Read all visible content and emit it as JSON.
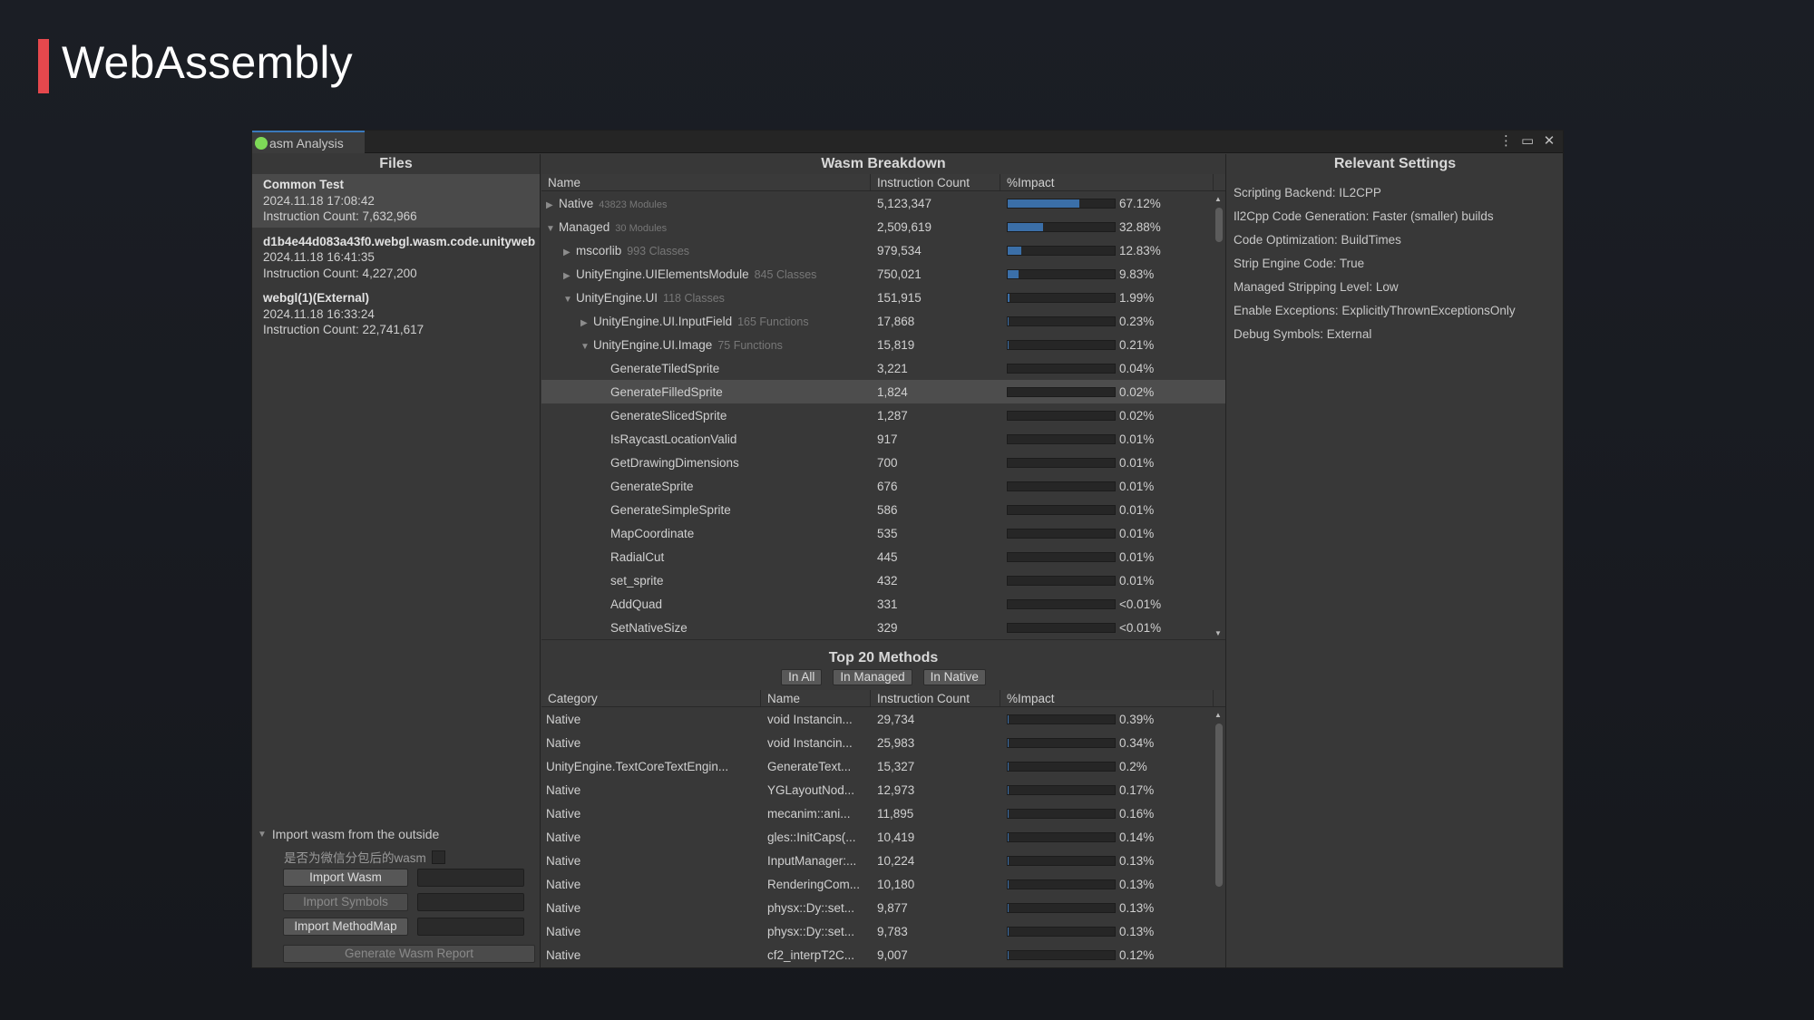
{
  "slide": {
    "title": "WebAssembly"
  },
  "window": {
    "tab_label": "asm Analysis",
    "controls": {
      "menu": "⋮",
      "maximize": "▭",
      "close": "✕"
    }
  },
  "files": {
    "header": "Files",
    "items": [
      {
        "name": "Common Test",
        "date": "2024.11.18 17:08:42",
        "count": "Instruction Count: 7,632,966"
      },
      {
        "name": "d1b4e44d083a43f0.webgl.wasm.code.unityweb",
        "date": "2024.11.18 16:41:35",
        "count": "Instruction Count: 4,227,200"
      },
      {
        "name": "webgl(1)(External)",
        "date": "2024.11.18 16:33:24",
        "count": "Instruction Count: 22,741,617"
      }
    ],
    "import": {
      "fold_label": "Import wasm from the outside",
      "checkbox_label": "是否为微信分包后的wasm",
      "import_wasm": "Import Wasm",
      "import_symbols": "Import Symbols",
      "import_methodmap": "Import MethodMap",
      "generate_report": "Generate Wasm Report"
    }
  },
  "breakdown": {
    "header": "Wasm Breakdown",
    "columns": [
      "Name",
      "Instruction Count",
      "%Impact"
    ],
    "rows": [
      {
        "arrow": "▶",
        "name": "Native",
        "note": "43823 Modules",
        "count": "5,123,347",
        "impact": 67.12,
        "pct": "67.12%"
      },
      {
        "arrow": "▼",
        "name": "Managed",
        "note": "30 Modules",
        "count": "2,509,619",
        "impact": 32.88,
        "pct": "32.88%"
      },
      {
        "arrow": "▶",
        "name": "mscorlib",
        "note": "993 Classes",
        "count": "979,534",
        "impact": 12.83,
        "pct": "12.83%"
      },
      {
        "arrow": "▶",
        "name": "UnityEngine.UIElementsModule",
        "note": "845 Classes",
        "count": "750,021",
        "impact": 9.83,
        "pct": "9.83%"
      },
      {
        "arrow": "▼",
        "name": "UnityEngine.UI",
        "note": "118 Classes",
        "count": "151,915",
        "impact": 1.99,
        "pct": "1.99%"
      },
      {
        "arrow": "▶",
        "name": "UnityEngine.UI.InputField",
        "note": "165 Functions",
        "count": "17,868",
        "impact": 0.23,
        "pct": "0.23%"
      },
      {
        "arrow": "▼",
        "name": "UnityEngine.UI.Image",
        "note": "75 Functions",
        "count": "15,819",
        "impact": 0.21,
        "pct": "0.21%"
      },
      {
        "arrow": "",
        "name": "GenerateTiledSprite",
        "note": "",
        "count": "3,221",
        "impact": 0.04,
        "pct": "0.04%"
      },
      {
        "arrow": "",
        "name": "GenerateFilledSprite",
        "note": "",
        "count": "1,824",
        "impact": 0.02,
        "pct": "0.02%"
      },
      {
        "arrow": "",
        "name": "GenerateSlicedSprite",
        "note": "",
        "count": "1,287",
        "impact": 0.02,
        "pct": "0.02%"
      },
      {
        "arrow": "",
        "name": "IsRaycastLocationValid",
        "note": "",
        "count": "917",
        "impact": 0.01,
        "pct": "0.01%"
      },
      {
        "arrow": "",
        "name": "GetDrawingDimensions",
        "note": "",
        "count": "700",
        "impact": 0.01,
        "pct": "0.01%"
      },
      {
        "arrow": "",
        "name": "GenerateSprite",
        "note": "",
        "count": "676",
        "impact": 0.01,
        "pct": "0.01%"
      },
      {
        "arrow": "",
        "name": "GenerateSimpleSprite",
        "note": "",
        "count": "586",
        "impact": 0.01,
        "pct": "0.01%"
      },
      {
        "arrow": "",
        "name": "MapCoordinate",
        "note": "",
        "count": "535",
        "impact": 0.01,
        "pct": "0.01%"
      },
      {
        "arrow": "",
        "name": "RadialCut",
        "note": "",
        "count": "445",
        "impact": 0.01,
        "pct": "0.01%"
      },
      {
        "arrow": "",
        "name": "set_sprite",
        "note": "",
        "count": "432",
        "impact": 0.01,
        "pct": "0.01%"
      },
      {
        "arrow": "",
        "name": "AddQuad",
        "note": "",
        "count": "331",
        "impact": 0.0,
        "pct": "<0.01%"
      },
      {
        "arrow": "",
        "name": "SetNativeSize",
        "note": "",
        "count": "329",
        "impact": 0.0,
        "pct": "<0.01%"
      }
    ],
    "selected_row": "GenerateFilledSprite"
  },
  "top20": {
    "header": "Top 20 Methods",
    "tabs": [
      "In All",
      "In Managed",
      "In Native"
    ],
    "columns": [
      "Category",
      "Name",
      "Instruction Count",
      "%Impact"
    ],
    "rows": [
      {
        "category": "Native",
        "name": "void Instancin...",
        "count": "29,734",
        "impact": 0.39,
        "pct": "0.39%"
      },
      {
        "category": "Native",
        "name": "void Instancin...",
        "count": "25,983",
        "impact": 0.34,
        "pct": "0.34%"
      },
      {
        "category": "UnityEngine.TextCoreTextEngin...",
        "name": "GenerateText...",
        "count": "15,327",
        "impact": 0.2,
        "pct": "0.2%"
      },
      {
        "category": "Native",
        "name": "YGLayoutNod...",
        "count": "12,973",
        "impact": 0.17,
        "pct": "0.17%"
      },
      {
        "category": "Native",
        "name": "mecanim::ani...",
        "count": "11,895",
        "impact": 0.16,
        "pct": "0.16%"
      },
      {
        "category": "Native",
        "name": "gles::InitCaps(...",
        "count": "10,419",
        "impact": 0.14,
        "pct": "0.14%"
      },
      {
        "category": "Native",
        "name": "InputManager:...",
        "count": "10,224",
        "impact": 0.13,
        "pct": "0.13%"
      },
      {
        "category": "Native",
        "name": "RenderingCom...",
        "count": "10,180",
        "impact": 0.13,
        "pct": "0.13%"
      },
      {
        "category": "Native",
        "name": "physx::Dy::set...",
        "count": "9,877",
        "impact": 0.13,
        "pct": "0.13%"
      },
      {
        "category": "Native",
        "name": "physx::Dy::set...",
        "count": "9,783",
        "impact": 0.13,
        "pct": "0.13%"
      },
      {
        "category": "Native",
        "name": "cf2_interpT2C...",
        "count": "9,007",
        "impact": 0.12,
        "pct": "0.12%"
      }
    ]
  },
  "settings": {
    "header": "Relevant Settings",
    "items": [
      "Scripting Backend: IL2CPP",
      "Il2Cpp Code Generation: Faster (smaller) builds",
      "Code Optimization: BuildTimes",
      "Strip Engine Code: True",
      "Managed Stripping Level: Low",
      "Enable Exceptions: ExplicitlyThrownExceptionsOnly",
      "Debug Symbols: External"
    ]
  },
  "colors": {
    "accent_bar": "#e5484d",
    "impact_bar": "#3b6fa8",
    "tab_icon": "#7ed957"
  }
}
